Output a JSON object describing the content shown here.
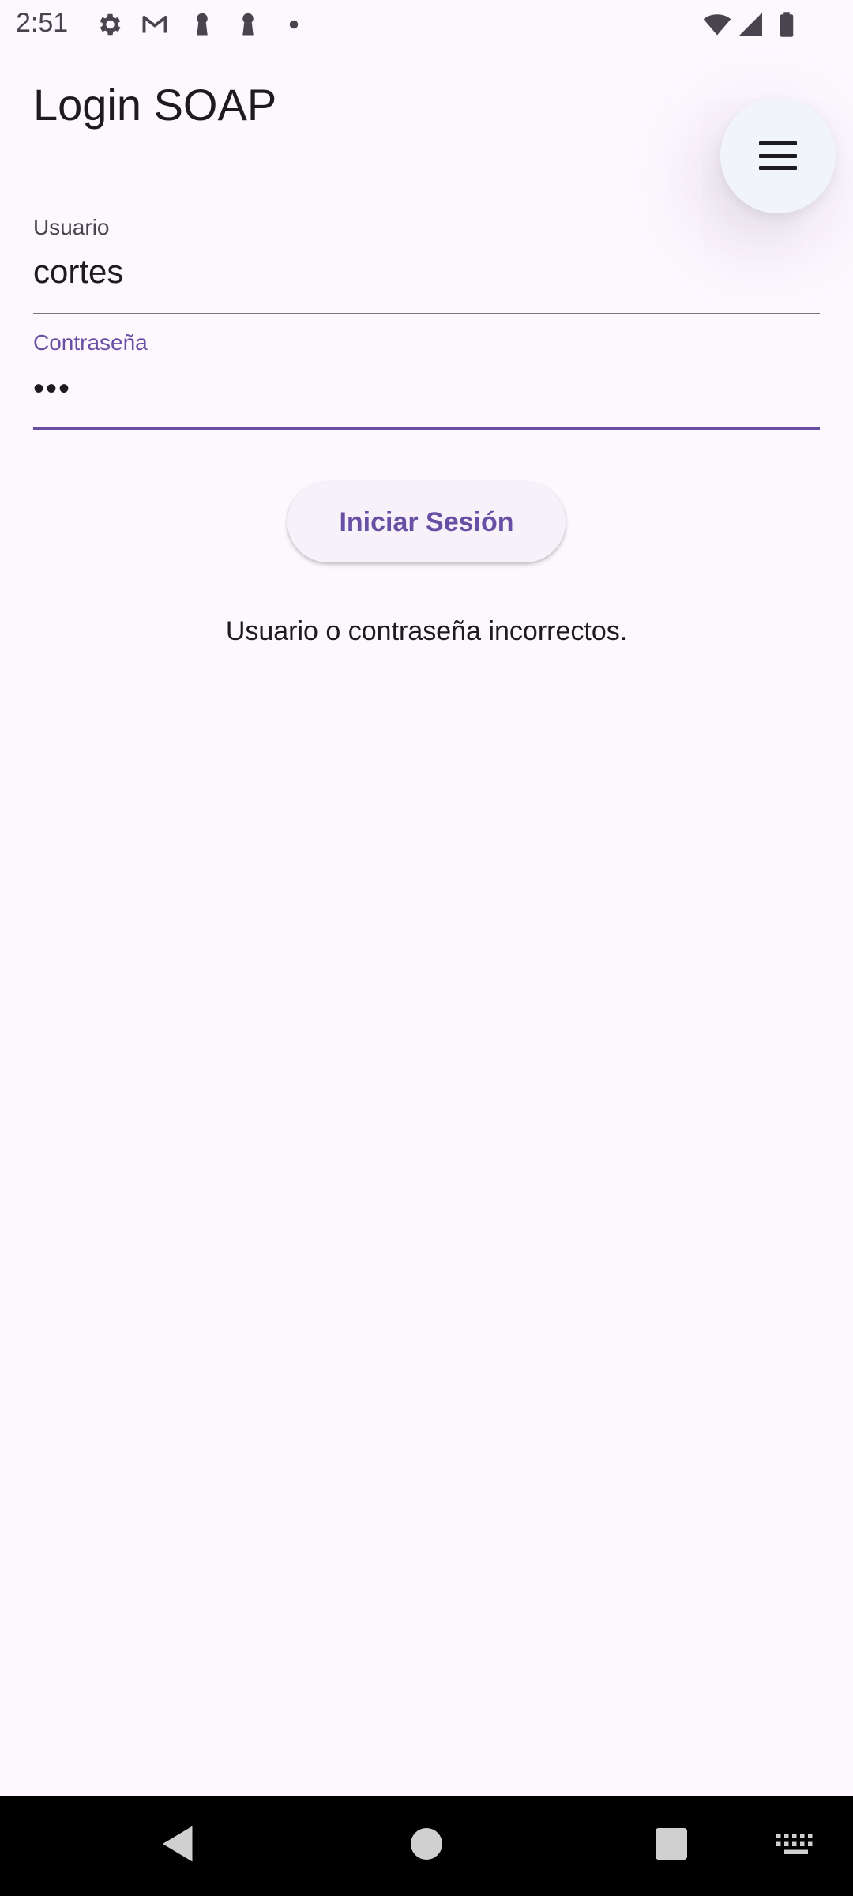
{
  "status_bar": {
    "time": "2:51",
    "left_icons": [
      "settings-icon",
      "gmail-icon",
      "keyhole-icon",
      "keyhole-icon",
      "dot-icon"
    ],
    "right_icons": [
      "wifi-icon",
      "signal-icon",
      "battery-icon"
    ]
  },
  "app_bar": {
    "title": "Login SOAP",
    "menu_icon": "menu-icon"
  },
  "form": {
    "username": {
      "label": "Usuario",
      "value": "cortes"
    },
    "password": {
      "label": "Contraseña",
      "value": "•••"
    },
    "login_button_label": "Iniciar Sesión",
    "error_message": "Usuario o contraseña incorrectos."
  },
  "nav_bar": {
    "buttons": [
      "back-icon",
      "home-icon",
      "recents-icon",
      "keyboard-icon"
    ]
  },
  "colors": {
    "background": "#fdf7fe",
    "primary": "#6750a4",
    "on_surface": "#1d1b20",
    "on_surface_variant": "#49454f",
    "fab_background": "#f1f5fa",
    "nav_background": "#000000"
  }
}
